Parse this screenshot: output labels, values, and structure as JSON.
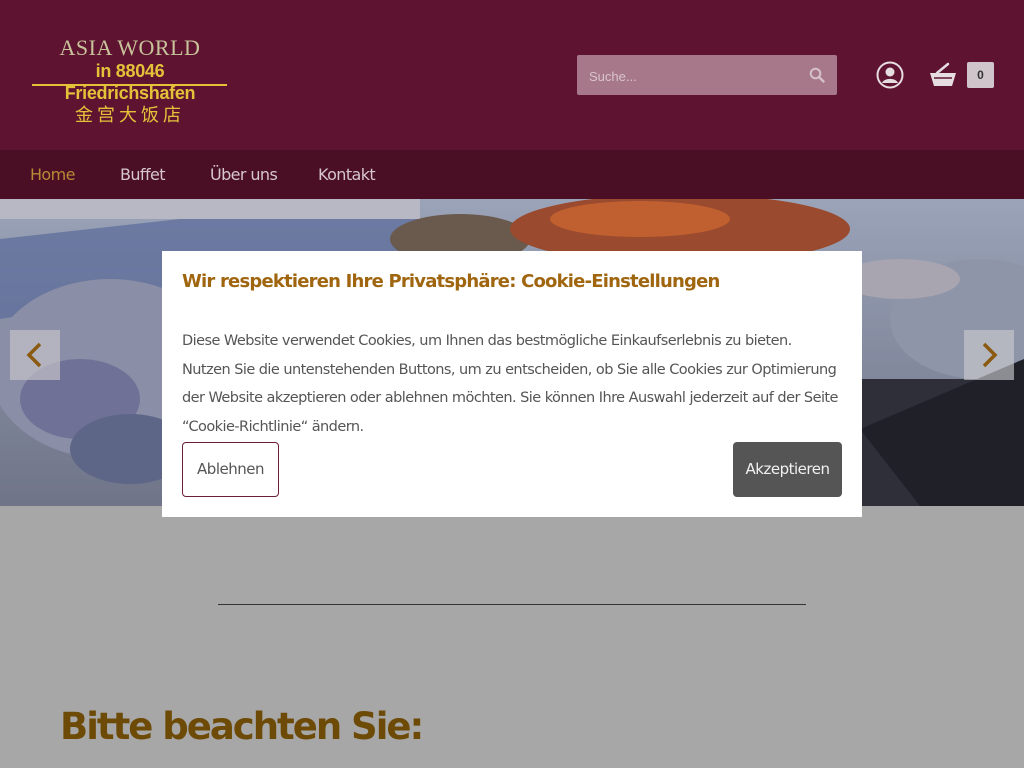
{
  "logo": {
    "line1": "ASIA WORLD",
    "line2": "in 88046 Friedrichshafen",
    "line3": "金宫大饭店"
  },
  "search": {
    "placeholder": "Suche...",
    "icon": "search-icon"
  },
  "header_icons": {
    "user": "user-icon",
    "cart": "cart-icon",
    "cart_count": "0"
  },
  "nav": {
    "items": [
      {
        "label": "Home",
        "active": true
      },
      {
        "label": "Buffet",
        "active": false
      },
      {
        "label": "Über uns",
        "active": false
      },
      {
        "label": "Kontakt",
        "active": false
      }
    ]
  },
  "slider": {
    "prev_icon": "chevron-left-icon",
    "next_icon": "chevron-right-icon"
  },
  "cookie_modal": {
    "title": "Wir respektieren Ihre Privatsphäre: Cookie-Einstellungen",
    "text": "Diese Website verwendet Cookies, um Ihnen das bestmögliche Einkaufserlebnis zu bieten. Nutzen Sie die untenstehenden Buttons, um zu entscheiden, ob Sie alle Cookies zur Optimierung der Website akzeptieren oder ablehnen möchten. Sie können Ihre Auswahl jederzeit auf der Seite “Cookie-Richtlinie“ ändern.",
    "decline_label": "Ablehnen",
    "accept_label": "Akzeptieren"
  },
  "main": {
    "notice_heading": "Bitte beachten Sie:"
  },
  "colors": {
    "header_bg": "#5e1430",
    "nav_bg": "#4a0f25",
    "accent": "#a0650f",
    "logo_gold": "#e5c13a",
    "overlay_bg": "#a7a7a7"
  }
}
